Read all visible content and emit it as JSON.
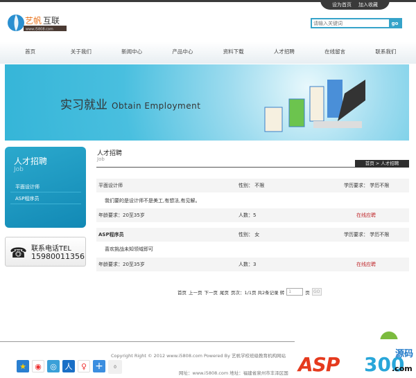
{
  "top_links": [
    "设为首页",
    "加入收藏"
  ],
  "logo": {
    "name": "艺帆互联",
    "url": "www.i5808.com"
  },
  "search": {
    "placeholder": "请输入关键词",
    "button": "go"
  },
  "nav": [
    "首页",
    "关于我们",
    "新闻中心",
    "产品中心",
    "资料下载",
    "人才招聘",
    "在线留言",
    "联系我们"
  ],
  "banner": {
    "title": "实习就业",
    "subtitle": "Obtain Employment"
  },
  "sidebar": {
    "title": "人才招聘",
    "subtitle": "Job",
    "items": [
      "平面设计师",
      "ASP程序员"
    ]
  },
  "phone": {
    "label": "联系电话TEL",
    "number": "15980011356"
  },
  "content": {
    "title": "人才招聘",
    "subtitle": "Job",
    "breadcrumb": "首页 > 人才招聘"
  },
  "jobs": [
    {
      "name": "平面设计师",
      "gender": "性别： 不限",
      "education": "学历要求： 学历不限",
      "desc": "我们要的是设计师不是美工,有想法,有见解。",
      "age": "年龄要求：20至35岁",
      "count": "人数：5",
      "apply": "在线应聘"
    },
    {
      "name": "ASP程序员",
      "gender": "性别： 女",
      "education": "学历要求： 学历不限",
      "desc": "喜欢挑战未知领域即可",
      "age": "年龄要求：20至35岁",
      "count": "人数：3",
      "apply": "在线应聘"
    }
  ],
  "pager": {
    "links": [
      "首页",
      "上一页",
      "下一页",
      "尾页"
    ],
    "info": "页次：1/1页 共2条记录 转",
    "input": "1",
    "unit": "页",
    "go": "GO"
  },
  "footer": {
    "copyright": "Copyright Right © 2012 www.i5808.com Powered By 艺帆学校班级教育机构网站",
    "address": "网址：www.i5808.com 地址：福建省泉州市丰泽区国",
    "share_count": "0"
  },
  "watermark": "ASP300源码.com"
}
